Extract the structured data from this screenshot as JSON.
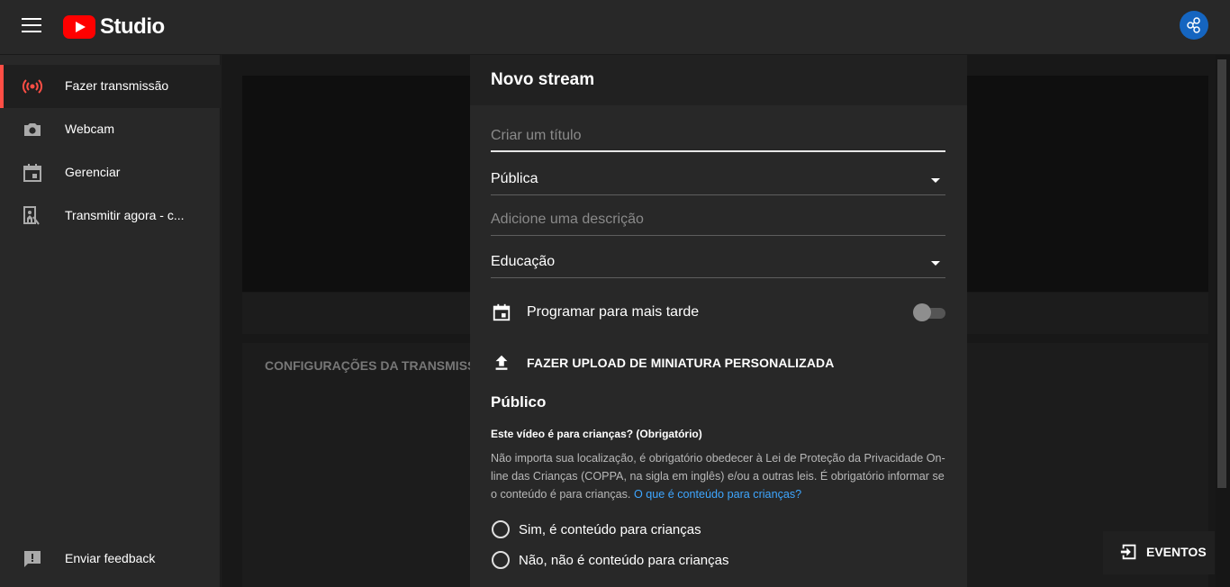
{
  "app": {
    "logo_text": "Studio"
  },
  "sidebar": {
    "items": [
      {
        "label": "Fazer transmissão",
        "icon": "live-broadcast-icon"
      },
      {
        "label": "Webcam",
        "icon": "camera-icon"
      },
      {
        "label": "Gerenciar",
        "icon": "calendar-icon"
      },
      {
        "label": "Transmitir agora - c...",
        "icon": "stream-now-icon"
      }
    ],
    "feedback_label": "Enviar feedback"
  },
  "background": {
    "settings_heading": "CONFIGURAÇÕES DA TRANSMISSÃO"
  },
  "dialog": {
    "title": "Novo stream",
    "title_field": {
      "placeholder": "Criar um título",
      "value": ""
    },
    "visibility_select": {
      "value": "Pública"
    },
    "description_field": {
      "placeholder": "Adicione uma descrição",
      "value": ""
    },
    "category_select": {
      "value": "Educação"
    },
    "schedule": {
      "label": "Programar para mais tarde",
      "enabled": false
    },
    "upload_thumbnail_label": "FAZER UPLOAD DE MINIATURA PERSONALIZADA",
    "audience": {
      "section_title": "Público",
      "question": "Este vídeo é para crianças? (Obrigatório)",
      "description": "Não importa sua localização, é obrigatório obedecer à Lei de Proteção da Privacidade On-line das Crianças (COPPA, na sigla em inglês) e/ou a outras leis. É obrigatório informar se o conteúdo é para crianças.",
      "link_text": "O que é conteúdo para crianças?",
      "options": [
        {
          "label": "Sim, é conteúdo para crianças",
          "selected": false
        },
        {
          "label": "Não, não é conteúdo para crianças",
          "selected": false
        }
      ]
    }
  },
  "events_button": {
    "label": "EVENTOS"
  },
  "colors": {
    "accent_red": "#ff4e45",
    "link_blue": "#3ea6ff",
    "avatar_blue": "#1565c0"
  }
}
